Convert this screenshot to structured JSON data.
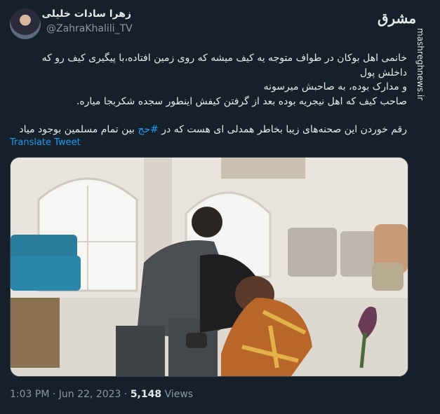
{
  "author": {
    "name": "زهرا سادات خلیلی",
    "handle": "@ZahraKhalili_TV"
  },
  "watermark": {
    "logo": "مشرق",
    "url": "mashreghnews.ir"
  },
  "tweet": {
    "lines": [
      "خانمی اهل بوکان در طواف متوجه یه کیف میشه که روی زمین افتاده،با پیگیری کیف رو که داخلش پول",
      "و مدارک بوده، به صاحبش میرسونه",
      "صاحب کیف که اهل نیجریه بوده بعد از گرفتن کیفش اینطور سجده شکربجا میاره."
    ],
    "last_line_before": "رقم خوردن این صحنه‌های زیبا بخاطر همدلی ای هست که در ",
    "hashtag": "#حج",
    "last_line_after": " بین تمام مسلمین بوجود میاد"
  },
  "translate_label": "Translate Tweet",
  "meta": {
    "time": "1:03 PM",
    "separator": "·",
    "date": "Jun 22, 2023",
    "views": "5,148",
    "views_label": "Views"
  },
  "icons": {
    "more": "more-options-icon"
  },
  "colors": {
    "background": "#15202b",
    "text": "#e7e9ea",
    "secondary": "#8b98a5",
    "link": "#1d9bf0"
  }
}
